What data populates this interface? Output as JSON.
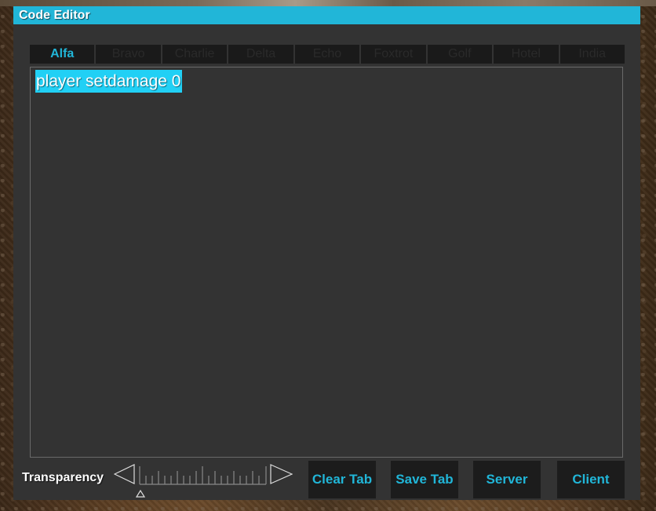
{
  "window": {
    "title": "Code Editor"
  },
  "tabs": [
    {
      "label": "Alfa",
      "active": true
    },
    {
      "label": "Bravo",
      "active": false
    },
    {
      "label": "Charlie",
      "active": false
    },
    {
      "label": "Delta",
      "active": false
    },
    {
      "label": "Echo",
      "active": false
    },
    {
      "label": "Foxtrot",
      "active": false
    },
    {
      "label": "Golf",
      "active": false
    },
    {
      "label": "Hotel",
      "active": false
    },
    {
      "label": "India",
      "active": false
    }
  ],
  "editor": {
    "code": "player setdamage 0"
  },
  "transparency": {
    "label": "Transparency",
    "value": 0,
    "left_icon": "triangle-left-icon",
    "right_icon": "triangle-right-icon"
  },
  "buttons": {
    "clear_tab": "Clear Tab",
    "save_tab": "Save Tab",
    "server": "Server",
    "client": "Client"
  },
  "colors": {
    "accent": "#21b6d8",
    "selection": "#21d0f5",
    "panel": "#333333",
    "tab_bg": "#1a1a1a"
  }
}
